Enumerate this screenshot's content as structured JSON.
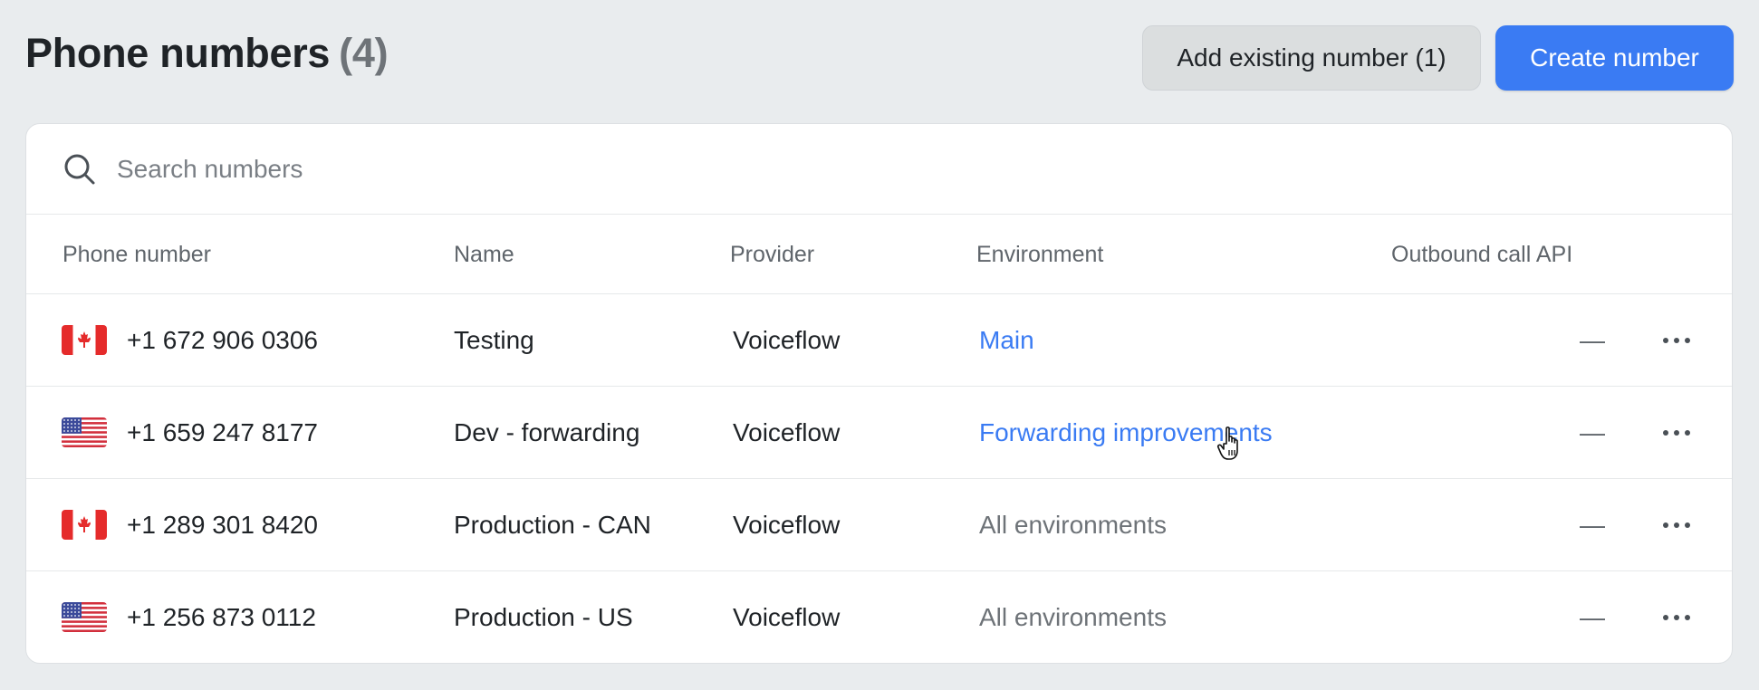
{
  "header": {
    "title": "Phone numbers",
    "count": "(4)",
    "add_existing_label": "Add existing number (1)",
    "create_label": "Create number"
  },
  "search": {
    "placeholder": "Search numbers",
    "value": ""
  },
  "table": {
    "columns": [
      "Phone number",
      "Name",
      "Provider",
      "Environment",
      "Outbound call API"
    ],
    "rows": [
      {
        "flag": "canada-flag-icon",
        "phone": "+1 672 906 0306",
        "name": "Testing",
        "provider": "Voiceflow",
        "environment": "Main",
        "env_style": "link",
        "outbound": "—"
      },
      {
        "flag": "us-flag-icon",
        "phone": "+1 659 247 8177",
        "name": "Dev - forwarding",
        "provider": "Voiceflow",
        "environment": "Forwarding improvements",
        "env_style": "link",
        "outbound": "—"
      },
      {
        "flag": "canada-flag-icon",
        "phone": "+1 289 301 8420",
        "name": "Production - CAN",
        "provider": "Voiceflow",
        "environment": "All environments",
        "env_style": "muted",
        "outbound": "—"
      },
      {
        "flag": "us-flag-icon",
        "phone": "+1 256 873 0112",
        "name": "Production - US",
        "provider": "Voiceflow",
        "environment": "All environments",
        "env_style": "muted",
        "outbound": "—"
      }
    ]
  },
  "colors": {
    "accent": "#3a7bf3",
    "background": "#e9ecee"
  }
}
